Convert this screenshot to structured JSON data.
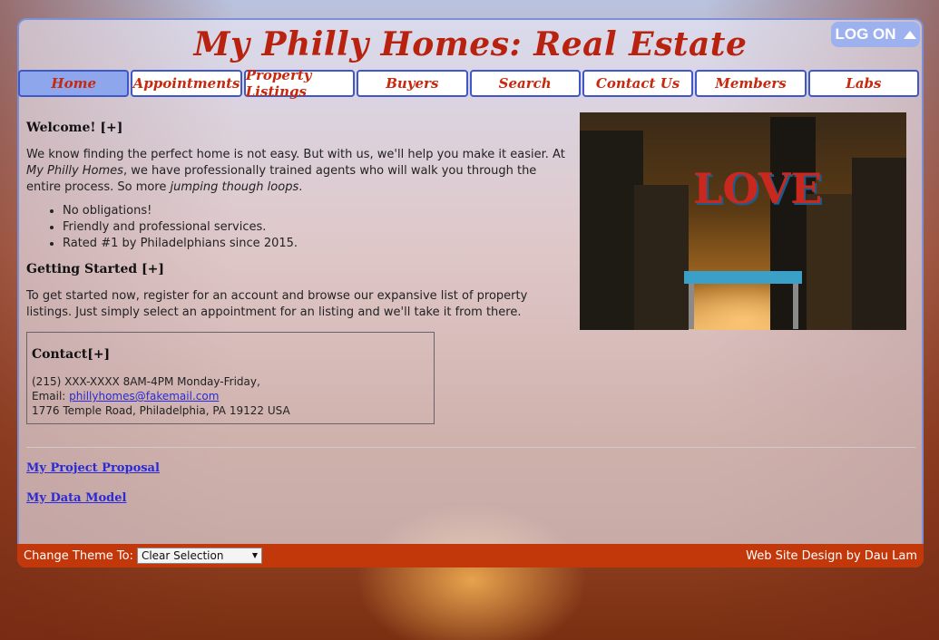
{
  "site": {
    "title": "My Philly Homes: Real Estate",
    "logon_label": "LOG ON"
  },
  "nav": {
    "items": [
      {
        "label": "Home"
      },
      {
        "label": "Appointments"
      },
      {
        "label": "Property Listings"
      },
      {
        "label": "Buyers"
      },
      {
        "label": "Search"
      },
      {
        "label": "Contact Us"
      },
      {
        "label": "Members"
      },
      {
        "label": "Labs"
      }
    ]
  },
  "welcome": {
    "heading": "Welcome! [+]",
    "p_part1": "We know finding the perfect home is not easy. But with us, we'll help you make it easier. At ",
    "p_em1": "My Philly Homes",
    "p_part2": ", we have professionally trained agents who will walk you through the entire process. So more ",
    "p_em2": "jumping though loops",
    "p_part3": ".",
    "bullets": [
      "No obligations!",
      "Friendly and professional services.",
      "Rated #1 by Philadelphians since 2015."
    ]
  },
  "getting_started": {
    "heading": "Getting Started [+]",
    "text": "To get started now, register for an account and browse our expansive list of property listings. Just simply select an appointment for an listing and we'll take it from there."
  },
  "contact": {
    "heading": "Contact[+]",
    "phone_hours": "(215) XXX-XXXX 8AM-4PM Monday-Friday,",
    "email_label": "Email: ",
    "email": "phillyhomes@fakemail.com",
    "address": "1776 Temple Road, Philadelphia, PA 19122 USA"
  },
  "hero": {
    "sign_text": "LOVE"
  },
  "links": {
    "proposal": "My Project Proposal",
    "data_model": "My Data Model"
  },
  "footer": {
    "theme_label": "Change Theme To:",
    "theme_selected": "Clear Selection",
    "credit": "Web Site Design by Dau Lam"
  }
}
